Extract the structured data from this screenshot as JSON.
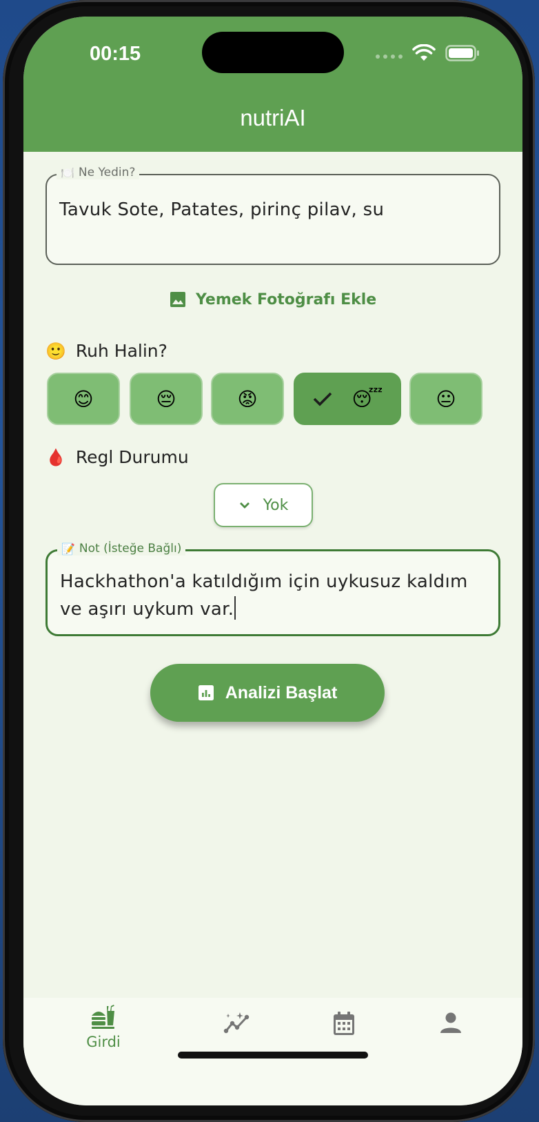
{
  "status_bar": {
    "time": "00:15"
  },
  "app_bar": {
    "title": "nutriAI"
  },
  "food_field": {
    "label": "Ne Yedin?",
    "label_icon": "fork-knife-plate-emoji",
    "value": "Tavuk Sote, Patates, pirinç pilav, su"
  },
  "photo_button": {
    "label": "Yemek Fotoğrafı Ekle",
    "icon": "image-icon"
  },
  "mood_section": {
    "title": "Ruh Halin?",
    "title_emoji": "🙂",
    "options": [
      {
        "emoji": "😊",
        "selected": false
      },
      {
        "emoji": "😔",
        "selected": false
      },
      {
        "emoji": "😡",
        "selected": false
      },
      {
        "emoji": "😴",
        "selected": true
      },
      {
        "emoji": "😐",
        "selected": false
      }
    ]
  },
  "period_section": {
    "title": "Regl Durumu",
    "title_emoji": "🩸",
    "dropdown_value": "Yok"
  },
  "note_field": {
    "label": "Not (İsteğe Bağlı)",
    "label_icon": "memo-emoji",
    "value": "Hackhathon'a katıldığım için uykusuz kaldım ve aşırı uykum var."
  },
  "analyze_button": {
    "label": "Analizi Başlat",
    "icon": "bar-chart-icon"
  },
  "bottom_nav": {
    "items": [
      {
        "label": "Girdi",
        "icon": "fastfood-icon",
        "active": true
      },
      {
        "label": "",
        "icon": "insights-icon",
        "active": false
      },
      {
        "label": "",
        "icon": "calendar-icon",
        "active": false
      },
      {
        "label": "",
        "icon": "person-icon",
        "active": false
      }
    ]
  },
  "colors": {
    "primary": "#5fa052",
    "background": "#f1f6ea",
    "chip": "#7fbd74",
    "accent_text": "#4e8e45",
    "icon_grey": "#757575"
  }
}
